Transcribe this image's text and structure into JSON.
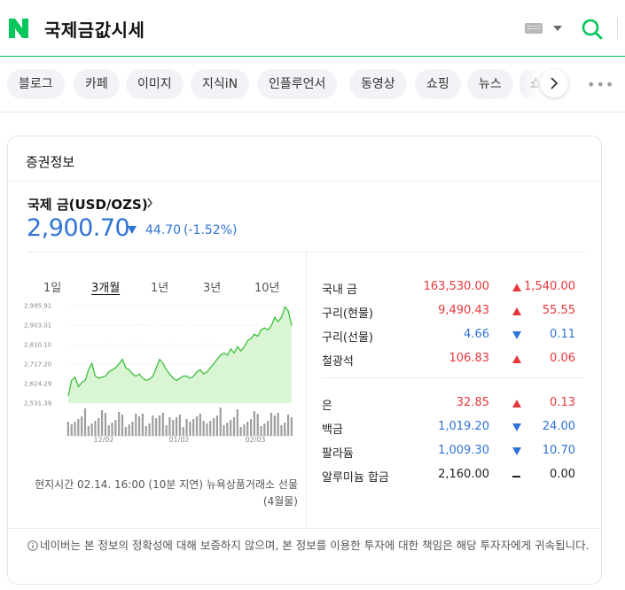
{
  "header": {
    "logo_letter": "N",
    "query": "국제금값시세",
    "brand_color": "#03c75a"
  },
  "tabs": [
    "블로그",
    "카페",
    "이미지",
    "지식iN",
    "인플루언서",
    "동영상",
    "쇼핑",
    "뉴스",
    "쇼"
  ],
  "card": {
    "title": "증권정보",
    "instrument": "국제 금(USD/OZS)",
    "price": "2,900.70",
    "change": "44.70",
    "change_pct": "(-1.52%)",
    "direction": "down",
    "periods": [
      {
        "label": "1일",
        "active": false
      },
      {
        "label": "3개월",
        "active": true
      },
      {
        "label": "1년",
        "active": false
      },
      {
        "label": "3년",
        "active": false
      },
      {
        "label": "10년",
        "active": false
      }
    ],
    "note_time": "현지시간 02.14. 16:00 (10분 지연) 뉴욕상품거래소 선물(4월물)",
    "disclaimer": "네이버는 본 정보의 정확성에 대해 보증하지 않으며, 본 정보를 이용한 투자에 대한 책임은 해당 투자자에게 귀속됩니다."
  },
  "metals": [
    {
      "name": "국내 금",
      "value": "163,530.00",
      "dir": "up",
      "change": "1,540.00"
    },
    {
      "name": "구리(현물)",
      "value": "9,490.43",
      "dir": "up",
      "change": "55.55"
    },
    {
      "name": "구리(선물)",
      "value": "4.66",
      "dir": "down",
      "change": "0.11"
    },
    {
      "name": "철광석",
      "value": "106.83",
      "dir": "up",
      "change": "0.06"
    },
    {
      "name": "은",
      "value": "32.85",
      "dir": "up",
      "change": "0.13"
    },
    {
      "name": "백금",
      "value": "1,019.20",
      "dir": "down",
      "change": "24.00"
    },
    {
      "name": "팔라듐",
      "value": "1,009.30",
      "dir": "down",
      "change": "10.70"
    },
    {
      "name": "알루미늄 합금",
      "value": "2,160.00",
      "dir": "flat",
      "change": "0.00"
    }
  ],
  "chart_data": {
    "type": "area",
    "yticks": [
      "2,995.91",
      "2,903.01",
      "2,810.10",
      "2,717.20",
      "2,624.29",
      "2,531.39"
    ],
    "ytick_values": [
      2995.91,
      2903.01,
      2810.1,
      2717.2,
      2624.29,
      2531.39
    ],
    "ylim": [
      2531.39,
      2995.91
    ],
    "xticks": [
      "12/02",
      "01/02",
      "02/03"
    ],
    "series": [
      {
        "values": [
          2565,
          2640,
          2655,
          2610,
          2630,
          2640,
          2690,
          2720,
          2660,
          2650,
          2655,
          2660,
          2680,
          2690,
          2700,
          2720,
          2740,
          2700,
          2690,
          2670,
          2660,
          2670,
          2650,
          2640,
          2645,
          2660,
          2700,
          2740,
          2720,
          2690,
          2670,
          2650,
          2640,
          2650,
          2660,
          2660,
          2650,
          2660,
          2680,
          2690,
          2670,
          2680,
          2700,
          2720,
          2740,
          2760,
          2770,
          2760,
          2790,
          2770,
          2800,
          2780,
          2800,
          2830,
          2840,
          2860,
          2850,
          2880,
          2890,
          2880,
          2900,
          2940,
          2920,
          2940,
          2990,
          2970,
          2900
        ]
      }
    ],
    "area_color": "#d9f5d3",
    "line_color": "#3fbf3f"
  }
}
